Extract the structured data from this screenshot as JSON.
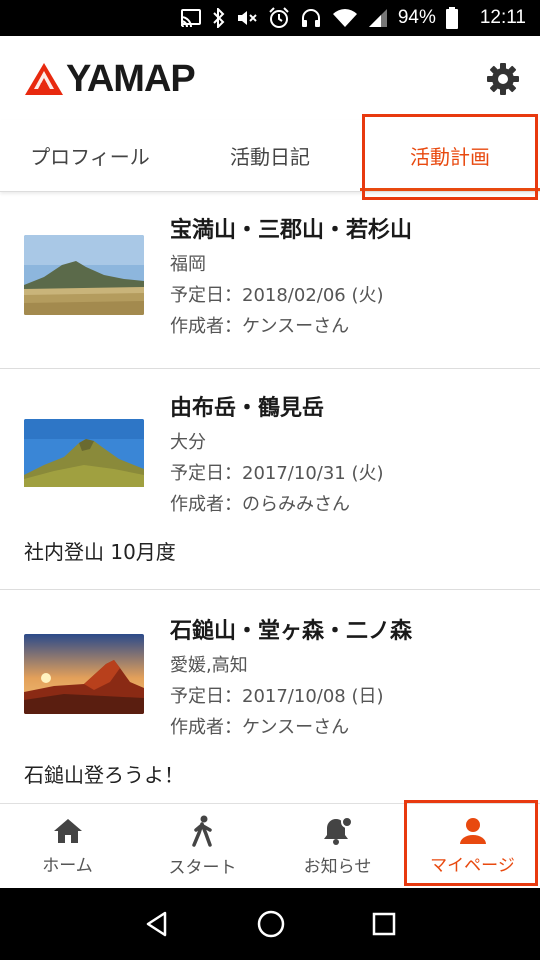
{
  "status_bar": {
    "battery": "94%",
    "time": "12:11",
    "icons": [
      "cast-icon",
      "bluetooth-icon",
      "mute-icon",
      "alarm-icon",
      "headset-icon",
      "wifi-icon",
      "signal-icon",
      "battery-icon"
    ]
  },
  "header": {
    "logo_text": "YAMAP",
    "settings_icon": "gear-icon"
  },
  "tabs": [
    {
      "label": "プロフィール",
      "active": false
    },
    {
      "label": "活動日記",
      "active": false
    },
    {
      "label": "活動計画",
      "active": true
    }
  ],
  "plans": [
    {
      "title": "宝満山・三郡山・若杉山",
      "region": "福岡",
      "scheduled": "予定日：2018/02/06 (火)",
      "author": "作成者：ケンスーさん",
      "memo": ""
    },
    {
      "title": "由布岳・鶴見岳",
      "region": "大分",
      "scheduled": "予定日：2017/10/31 (火)",
      "author": "作成者：のらみみさん",
      "memo": "社内登山 10月度"
    },
    {
      "title": "石鎚山・堂ヶ森・二ノ森",
      "region": "愛媛,高知",
      "scheduled": "予定日：2017/10/08 (日)",
      "author": "作成者：ケンスーさん",
      "memo": "石鎚山登ろうよ！"
    }
  ],
  "bottom_nav": [
    {
      "label": "ホーム",
      "icon": "home-icon",
      "active": false
    },
    {
      "label": "スタート",
      "icon": "walker-icon",
      "active": false
    },
    {
      "label": "お知らせ",
      "icon": "bell-icon",
      "active": false
    },
    {
      "label": "マイページ",
      "icon": "person-icon",
      "active": true
    }
  ],
  "colors": {
    "accent": "#e8490f",
    "highlight_box": "#e8390f"
  }
}
